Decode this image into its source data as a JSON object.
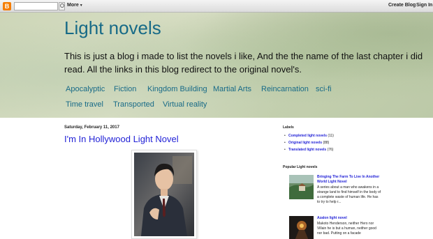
{
  "navbar": {
    "logo": "B",
    "more_label": "More",
    "create_blog": "Create Blog",
    "sign_in": "Sign In"
  },
  "header": {
    "title": "Light novels",
    "description": "This is just a blog i made to list the novels i like, And the the name of the last chapter i did read. All the links in this blog redirect to the original novel's.",
    "tabs": [
      "Apocalyptic",
      "Fiction",
      "Kingdom Building",
      "Martial Arts",
      "Reincarnation",
      "sci-fi",
      "Time travel",
      "Transported",
      "Virtual reality"
    ]
  },
  "post": {
    "date": "Saturday, February 11, 2017",
    "title": "I'm In Hollywood Light Novel"
  },
  "sidebar": {
    "labels_title": "Labels",
    "labels": [
      {
        "name": "Completed light novels",
        "count": "(11)"
      },
      {
        "name": "Original light novels",
        "count": "(88)"
      },
      {
        "name": "Translated light novels",
        "count": "(76)"
      }
    ],
    "popular_title": "Popular Light novels",
    "popular": [
      {
        "title": "Bringing The Farm To Live In Another World Light Novel",
        "snippet": "A series about a man who awakens in a strange land to find himself in the body of a complete waste of human life. He has to try to help r..."
      },
      {
        "title": "Azalon light novel",
        "snippet": "Makoto Henderson, neither Hero nor Villain he is but a human, neither good nor bad. Putting on a facade"
      }
    ]
  },
  "colors": {
    "title_teal": "#176a87",
    "link_blue": "#1f1fd6",
    "blogger_orange": "#f57d00"
  }
}
